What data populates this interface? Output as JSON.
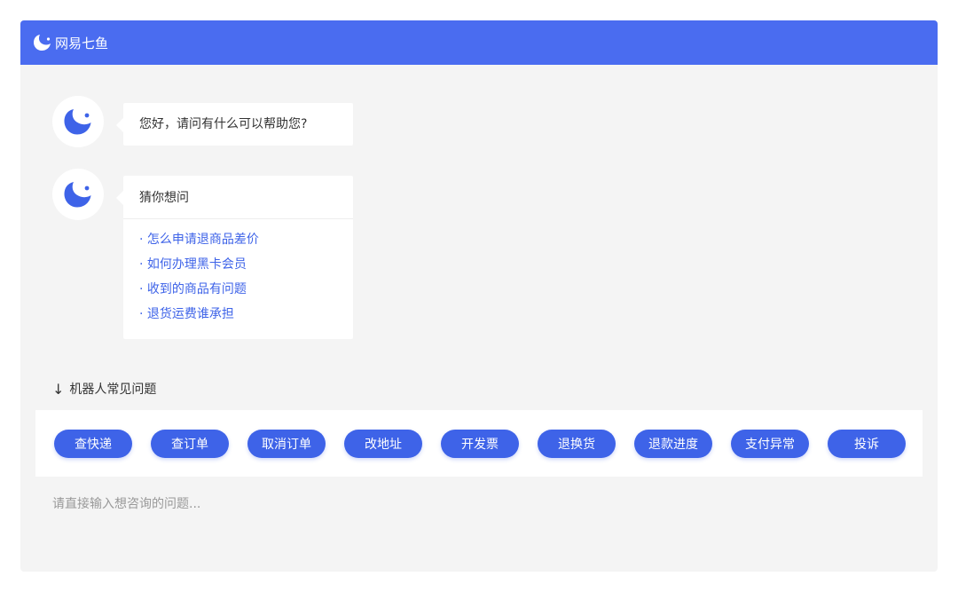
{
  "app": {
    "brand_name": "网易七鱼",
    "accent_color": "#4a6cf0",
    "logo_icon": "qiyu-fish-logo-icon"
  },
  "chat": {
    "greeting": "您好，请问有什么可以帮助您?",
    "guess": {
      "title": "猜你想问",
      "items": [
        "· 怎么申请退商品差价",
        "· 如何办理黑卡会员",
        "· 收到的商品有问题",
        "· 退货运费谁承担"
      ]
    }
  },
  "faq": {
    "arrow": "↓",
    "title": "机器人常见问题",
    "buttons": [
      "查快递",
      "查订单",
      "取消订单",
      "改地址",
      "开发票",
      "退换货",
      "退款进度",
      "支付异常",
      "投诉"
    ]
  },
  "input": {
    "placeholder": "请直接输入想咨询的问题..."
  }
}
